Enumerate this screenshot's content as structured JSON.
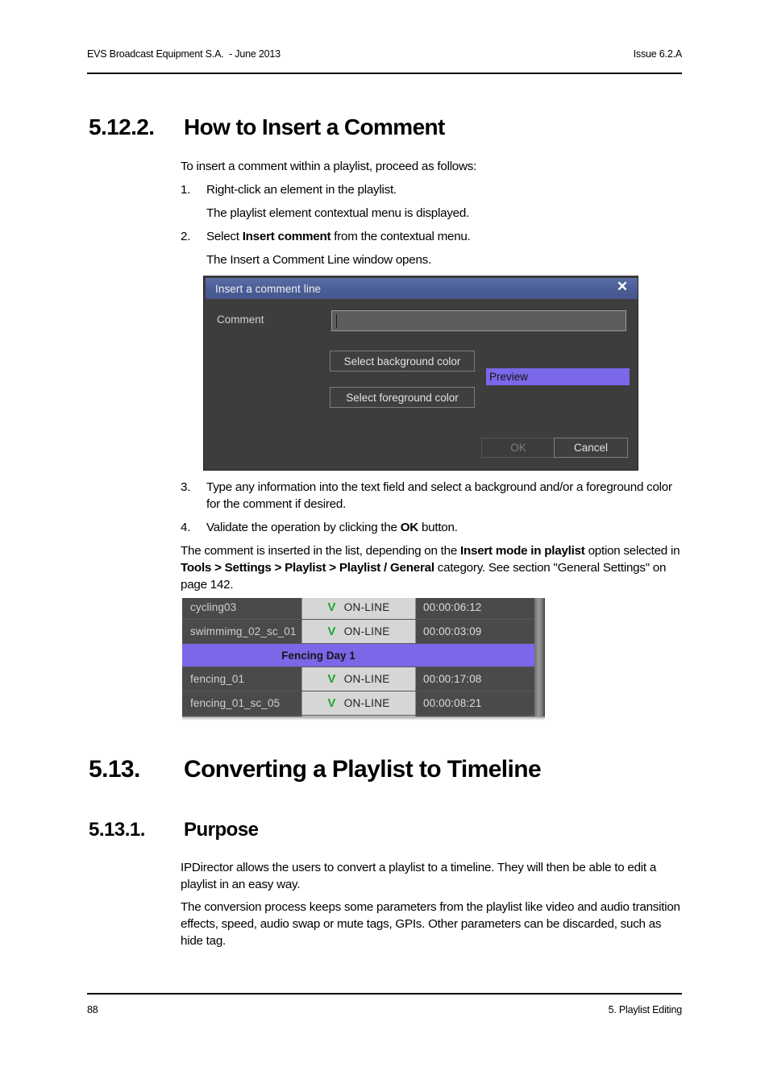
{
  "header": {
    "left": "EVS Broadcast Equipment S.A.  - June 2013",
    "right": "Issue 6.2.A"
  },
  "footer": {
    "page_number": "88",
    "section": "5. Playlist Editing"
  },
  "sections": {
    "insert_comment": {
      "number": "5.12.2.",
      "title": "How to Insert a Comment",
      "intro": "To insert a comment within a playlist, proceed as follows:",
      "steps": [
        {
          "marker": "1.",
          "text": "Right-click an element in the playlist.",
          "result": "The playlist element contextual menu is displayed."
        },
        {
          "marker": "2.",
          "text_before": "Select ",
          "text_bold": "Insert comment",
          "text_after": " from the contextual menu.",
          "result": "The Insert a Comment Line window opens."
        },
        {
          "marker": "3.",
          "text": "Type any information into the text field and select a background and/or a foreground color for the comment if desired."
        },
        {
          "marker": "4.",
          "text_before": "Validate the operation by clicking the ",
          "text_bold": "OK",
          "text_after": " button."
        }
      ],
      "closing": {
        "p1": "The comment is inserted in the list, depending on the ",
        "b1": "Insert mode in playlist",
        "p2": " option selected in ",
        "b2": "Tools > Settings > Playlist > Playlist / General",
        "p3": " category. See section \"General Settings\" on page 142."
      }
    },
    "converting": {
      "number": "5.13.",
      "title": "Converting a Playlist to Timeline"
    },
    "purpose": {
      "number": "5.13.1.",
      "title": "Purpose",
      "paragraphs": [
        "IPDirector allows the users to convert a playlist to a timeline. They will then be able to edit a playlist in an easy way.",
        "The conversion process keeps some parameters from the playlist like video and audio transition effects, speed, audio swap or mute tags, GPIs. Other parameters can be discarded, such as hide tag."
      ]
    }
  },
  "dialog": {
    "title": "Insert a comment line",
    "close_icon": "✕",
    "comment_label": "Comment",
    "comment_value": "",
    "select_background_label": "Select background color",
    "select_foreground_label": "Select foreground color",
    "preview_label": "Preview",
    "preview_bg_color": "#7a68e8",
    "preview_fg_color": "#141414",
    "titlebar_color": "#4a5d96",
    "ok_label": "OK",
    "cancel_label": "Cancel"
  },
  "playlist": {
    "status_check_glyph": "V",
    "comment_bg_color": "#7a68e8",
    "rows": [
      {
        "type": "clip",
        "name": "cycling03",
        "status": "ON-LINE",
        "duration": "00:00:06:12"
      },
      {
        "type": "clip",
        "name": "swimmimg_02_sc_01",
        "status": "ON-LINE",
        "duration": "00:00:03:09"
      },
      {
        "type": "comment",
        "name": "Fencing Day 1"
      },
      {
        "type": "clip",
        "name": "fencing_01",
        "status": "ON-LINE",
        "duration": "00:00:17:08"
      },
      {
        "type": "clip",
        "name": "fencing_01_sc_05",
        "status": "ON-LINE",
        "duration": "00:00:08:21"
      }
    ]
  }
}
